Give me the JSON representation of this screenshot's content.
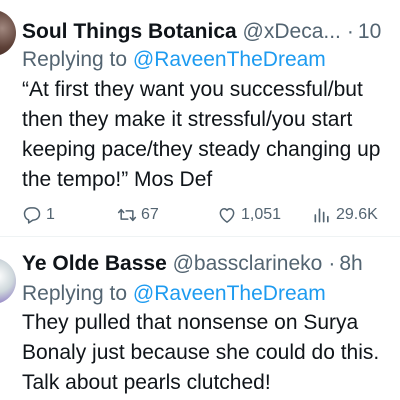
{
  "tweets": [
    {
      "display_name": "Soul Things Botanica",
      "handle": "@xDeca...",
      "separator": "·",
      "time": "10",
      "replying_prefix": "Replying to ",
      "replying_to": "@RaveenTheDream",
      "body_lines": [
        "“At first they want you successful/but",
        "then they make it stressful/you start",
        "keeping pace/they steady changing up",
        "the tempo!” Mos Def"
      ],
      "stats": {
        "replies": "1",
        "retweets": "67",
        "likes": "1,051",
        "views": "29.6K"
      },
      "icons": {
        "reply": "reply-icon",
        "retweet": "retweet-icon",
        "like": "heart-icon",
        "views": "views-icon"
      }
    },
    {
      "display_name": "Ye Olde Basse",
      "handle": "@bassclarineko",
      "separator": "·",
      "time": "8h",
      "replying_prefix": "Replying to ",
      "replying_to": "@RaveenTheDream",
      "body_lines": [
        "They pulled that nonsense on Surya",
        "Bonaly just because she could do this.",
        "Talk about pearls clutched!"
      ]
    }
  ],
  "colors": {
    "text": "#0f1419",
    "secondary": "#536471",
    "link": "#1d9bf0",
    "divider": "#eff3f4"
  }
}
